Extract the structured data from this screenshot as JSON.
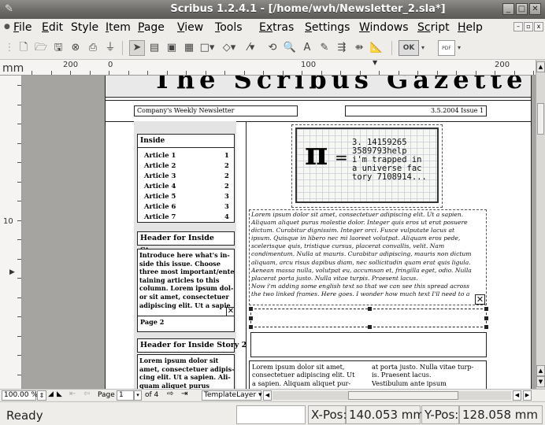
{
  "window": {
    "title": "Scribus 1.2.4.1 - [/home/wvh/Newsletter_2.sla*]"
  },
  "menu": {
    "items": [
      {
        "first": "F",
        "rest": "ile"
      },
      {
        "first": "E",
        "rest": "dit"
      },
      {
        "first": "Sty",
        "rest": "le",
        "u": "l"
      },
      {
        "first": "I",
        "rest": "tem"
      },
      {
        "first": "P",
        "rest": "age"
      },
      {
        "first": "V",
        "rest": "iew"
      },
      {
        "first": "T",
        "rest": "ools"
      },
      {
        "first": "Ex",
        "rest": "tras"
      },
      {
        "first": "S",
        "rest": "ettings"
      },
      {
        "first": "W",
        "rest": "indows"
      },
      {
        "first": "Sc",
        "rest": "ript"
      },
      {
        "first": "H",
        "rest": "elp"
      }
    ],
    "labels": [
      "File",
      "Edit",
      "Style",
      "Item",
      "Page",
      "View",
      "Tools",
      "Extras",
      "Settings",
      "Windows",
      "Script",
      "Help"
    ]
  },
  "toolbar": {
    "ok_label": "OK",
    "pdf_label": "PDF"
  },
  "ruler": {
    "unit": "mm",
    "h_labels": [
      "200",
      "0",
      "100",
      "200"
    ],
    "v_label": "10"
  },
  "document": {
    "masthead": "The Scribus Gazette",
    "weekly_label": "Company's Weekly Newsletter",
    "issue_label": "3.5.2004 Issue 1",
    "inside_title": "Inside",
    "articles": [
      {
        "label": "Article 1",
        "page": "1"
      },
      {
        "label": "Article 2",
        "page": "2"
      },
      {
        "label": "Article 3",
        "page": "2"
      },
      {
        "label": "Article 4",
        "page": "2"
      },
      {
        "label": "Article 5",
        "page": "3"
      },
      {
        "label": "Article 6",
        "page": "3"
      },
      {
        "label": "Article 7",
        "page": "4"
      }
    ],
    "story1_header": "Header for  Inside Story",
    "story1_lines": [
      "Introduce here what's in-",
      "side this issue. Choose",
      "three most important/enter-",
      "taining articles to this",
      "column. Lorem ipsum dol-",
      "or sit amet, consectetuer",
      "adipiscing elit. Ut a sapie"
    ],
    "story1_page": "Page 2",
    "story2_header": "Header for  Inside Story 2",
    "story2_lines": [
      "Lorem ipsum dolor sit",
      "amet, consectetuer adipis-",
      "cing elit. Ut a sapien. Ali-",
      "quam aliquet purus"
    ],
    "pi_lines": [
      "3. 14159265",
      "3589793help",
      "i'm trapped in",
      "a universe fac",
      "tory 7108914..."
    ],
    "main_text_lines": [
      "Lorem ipsum dolor sit amet, consectetuer adipiscing elit. Ut a sapien.",
      "Aliquam aliquet purus molestie dolor. Integer quis eros ut erat posuere",
      "dictum. Curabitur dignissim. Integer orci. Fusce vulputate lacus at",
      "ipsum. Quisque in libero nec mi laoreet volutpat. Aliquam eros pede,",
      "scelerisque quis, tristique cursus, placerat convallis, velit. Nam",
      "condimentum. Nulla ut mauris. Curabitur adipiscing, mauris non dictum",
      "aliquam, arcu risus dapibus diam, nec sollicitudin quam erat quis ligula.",
      "Aenean massa nulla, volutpat eu, accumsan et, fringilla eget, odio. Nulla",
      "placerat porta justo. Nulla vitae turpis. Praesent lacus.",
      "Now i'm adding some english text so that we can see this spread across",
      "the two linked frames. Here goes. I wonder how much text I'll need to a"
    ],
    "col_left_lines": [
      "Lorem  ipsum  dolor  sit  amet,",
      "consectetuer  adipiscing  elit.  Ut",
      "a  sapien.  Aliquam  aliquet  pur-"
    ],
    "col_right_lines": [
      "at  porta justo.  Nulla vitae turp-",
      "is.  Praesent lacus.",
      "Vestibulum          ante          ipsum"
    ]
  },
  "bottom": {
    "zoom": "100.00 %",
    "page_label": "Page",
    "page_value": "1",
    "of_label": "of 4",
    "layer": "TemplateLayer"
  },
  "status": {
    "ready": "Ready",
    "xpos_label": "X-Pos:",
    "xpos_value": "140.053 mm",
    "ypos_label": "Y-Pos:",
    "ypos_value": "128.058 mm"
  }
}
